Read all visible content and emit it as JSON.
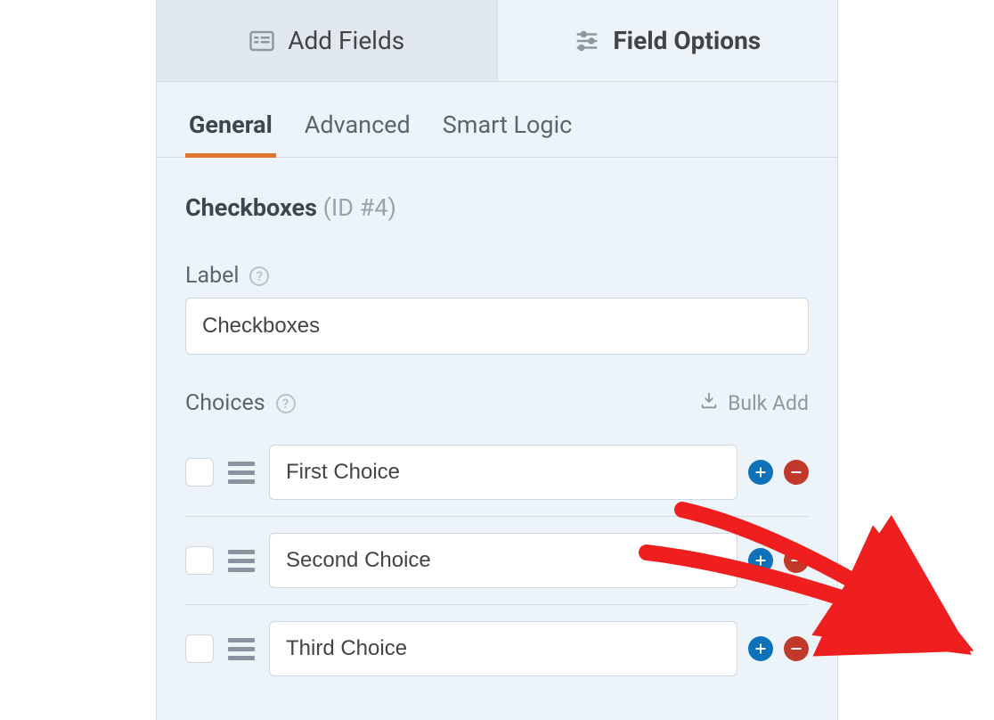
{
  "top_tabs": {
    "add_fields": "Add Fields",
    "field_options": "Field Options"
  },
  "sub_tabs": {
    "general": "General",
    "advanced": "Advanced",
    "smart_logic": "Smart Logic"
  },
  "field": {
    "type_label": "Checkboxes",
    "id_label": "(ID #4)"
  },
  "label_section": {
    "title": "Label",
    "value": "Checkboxes"
  },
  "choices_section": {
    "title": "Choices",
    "bulk_add": "Bulk Add",
    "items": [
      {
        "value": "First Choice"
      },
      {
        "value": "Second Choice"
      },
      {
        "value": "Third Choice"
      }
    ]
  }
}
